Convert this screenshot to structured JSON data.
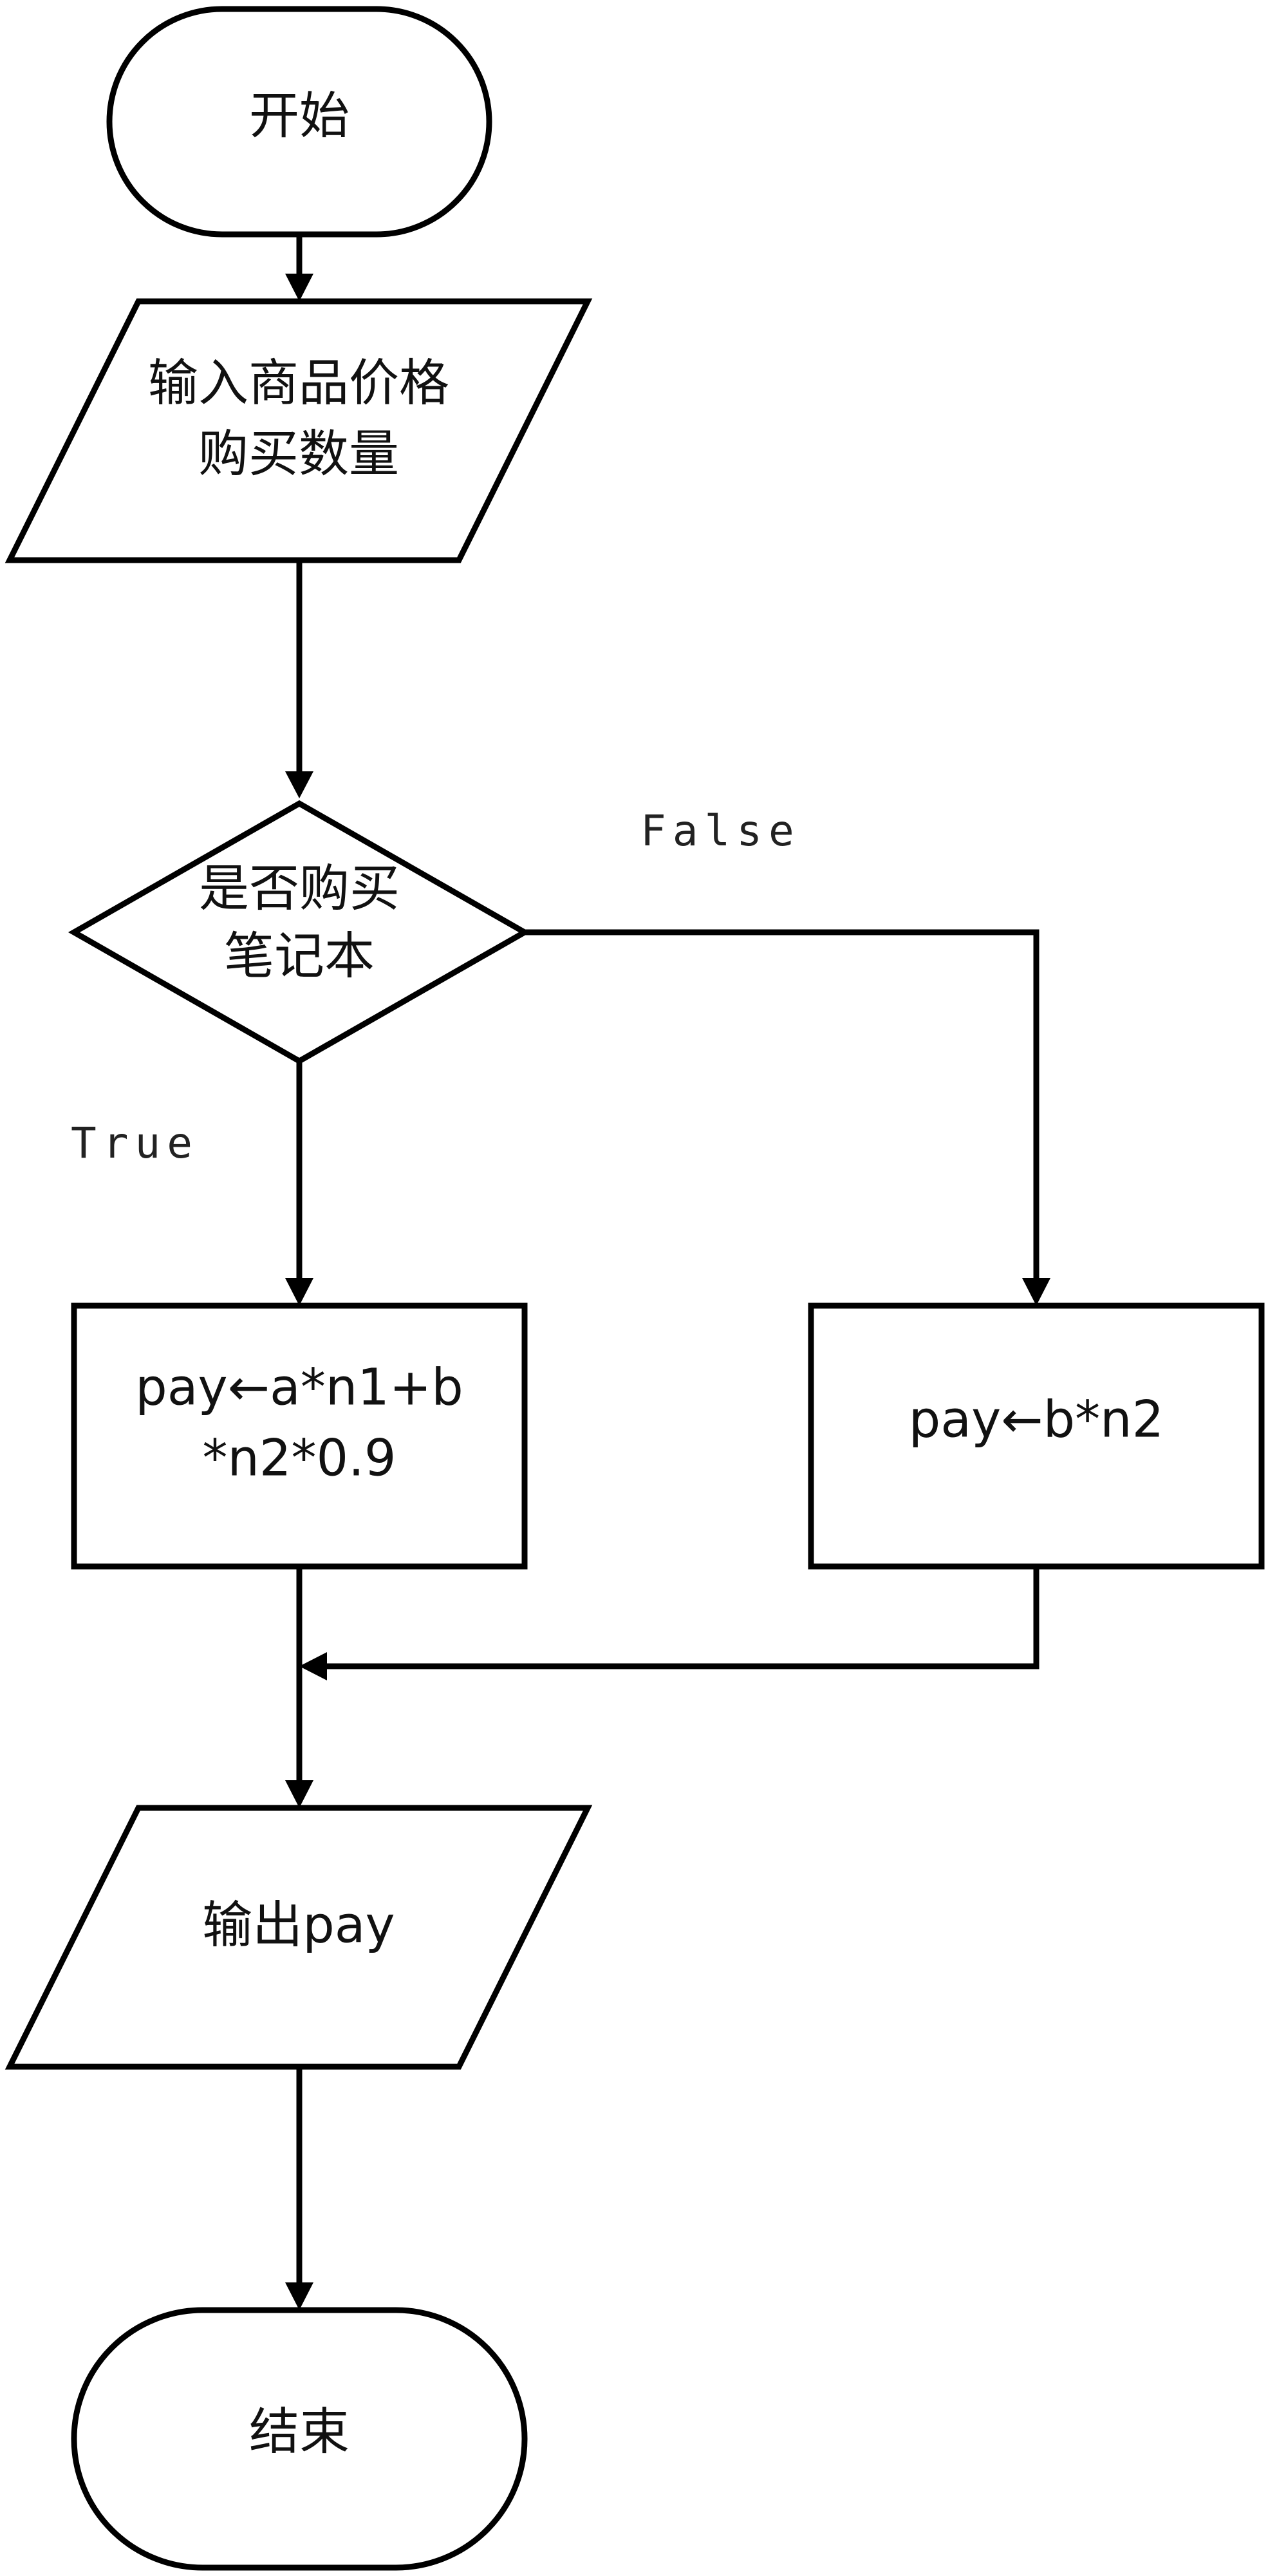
{
  "nodes": {
    "start": {
      "text": "开始"
    },
    "input": {
      "line1": "输入商品价格",
      "line2": "购买数量"
    },
    "decision": {
      "line1": "是否购买",
      "line2": "笔记本"
    },
    "calc_true": {
      "line1": "pay←a*n1+b",
      "line2": "*n2*0.9"
    },
    "calc_false": {
      "text": "pay←b*n2"
    },
    "output": {
      "text": "输出pay"
    },
    "end": {
      "text": "结束"
    }
  },
  "edges": {
    "false_label": "False",
    "true_label": "True"
  }
}
